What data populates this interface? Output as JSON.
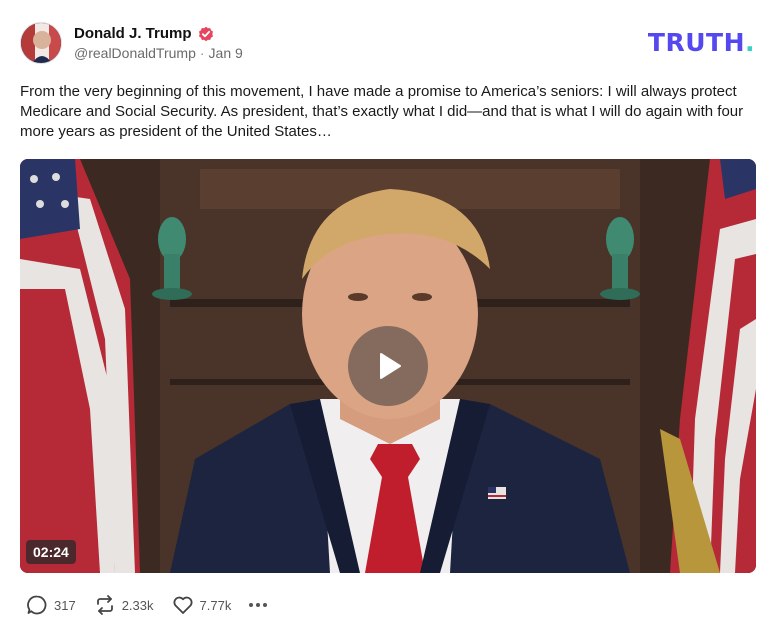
{
  "author": {
    "name": "Donald J. Trump",
    "handle": "@realDonaldTrump",
    "separator": "·",
    "date": "Jan 9",
    "avatar_icon": "portrait-avatar",
    "verified_icon": "verified-badge-icon",
    "verified_color": "#e6455f"
  },
  "brand": {
    "text": "TRUTH",
    "period": ".",
    "color": "#5448ee",
    "period_color": "#35d1c4"
  },
  "post": {
    "text": "From the very beginning of this movement, I have made a promise to America’s seniors: I will always protect Medicare and Social Security. As president, that’s exactly what I did—and that is what I will do again with four more years as president of the United States…"
  },
  "video": {
    "duration": "02:24",
    "play_icon": "play-icon"
  },
  "actions": {
    "replies": "317",
    "retruths": "2.33k",
    "likes": "7.77k",
    "reply_icon": "comment-icon",
    "retruth_icon": "repost-icon",
    "like_icon": "heart-icon",
    "more_icon": "more-icon"
  }
}
